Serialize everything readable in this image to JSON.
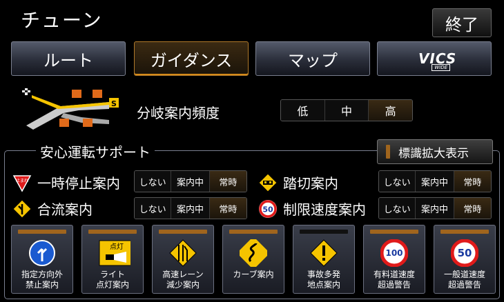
{
  "header": {
    "title": "チューン",
    "end_label": "終了"
  },
  "tabs": [
    {
      "label": "ルート",
      "active": false
    },
    {
      "label": "ガイダンス",
      "active": true
    },
    {
      "label": "マップ",
      "active": false
    },
    {
      "label": "VICS",
      "sub": "WIDE",
      "active": false
    }
  ],
  "branch": {
    "label": "分岐案内頻度",
    "options": [
      "低",
      "中",
      "高"
    ],
    "selected": "高"
  },
  "safety": {
    "title": "安心運転サポート",
    "enlarge_label": "標識拡大表示",
    "rows": [
      {
        "label": "一時停止案内",
        "icon": "stop-sign-icon",
        "options": [
          "しない",
          "案内中",
          "常時"
        ],
        "selected": "常時"
      },
      {
        "label": "踏切案内",
        "icon": "railroad-crossing-icon",
        "options": [
          "しない",
          "案内中",
          "常時"
        ],
        "selected": "常時"
      },
      {
        "label": "合流案内",
        "icon": "merge-sign-icon",
        "options": [
          "しない",
          "案内中",
          "常時"
        ],
        "selected": "常時"
      },
      {
        "label": "制限速度案内",
        "icon": "speed-limit-icon",
        "speed": "50",
        "options": [
          "しない",
          "案内中",
          "常時"
        ],
        "selected": "常時"
      }
    ],
    "cards": [
      {
        "label": "指定方向外\n禁止案内",
        "icon": "direction-sign-icon",
        "on": true
      },
      {
        "label": "ライト\n点灯案内",
        "icon": "light-sign-icon",
        "icon_text": "点灯",
        "on": true
      },
      {
        "label": "高速レーン\n減少案内",
        "icon": "lane-reduction-icon",
        "on": true
      },
      {
        "label": "カーブ案内",
        "icon": "curve-sign-icon",
        "on": true
      },
      {
        "label": "事故多発\n地点案内",
        "icon": "accident-warning-icon",
        "on": false
      },
      {
        "label": "有料道速度\n超過警告",
        "icon": "speed-100-icon",
        "speed": "100",
        "on": true
      },
      {
        "label": "一般道速度\n超過警告",
        "icon": "speed-50-icon",
        "speed": "50",
        "on": true
      }
    ]
  },
  "stop_sign_text": "止まれ",
  "colors": {
    "accent": "#d48a1a",
    "indicator": "#a0651d",
    "selected_bg": "#2a1f10"
  }
}
